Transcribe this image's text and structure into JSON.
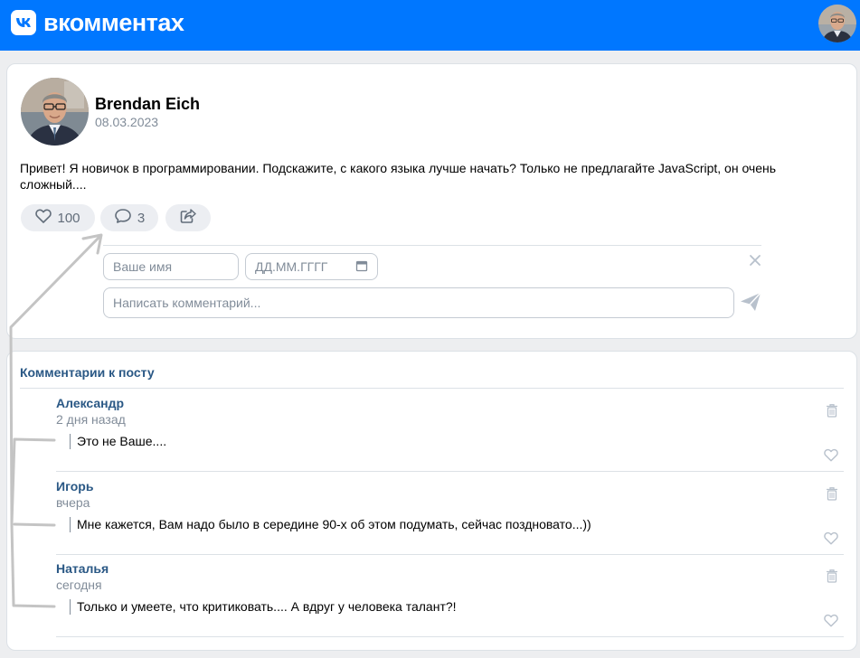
{
  "header": {
    "logo_text": "вкомментах"
  },
  "post": {
    "author_name": "Brendan Eich",
    "date": "08.03.2023",
    "text": "Привет! Я новичок в программировании. Подскажите, с какого языка лучше начать? Только не предлагайте JavaScript, он очень сложный....",
    "likes": "100",
    "comments_count": "3"
  },
  "form": {
    "name_placeholder": "Ваше имя",
    "date_placeholder": "ДД.ММ.ГГГГ",
    "comment_placeholder": "Написать комментарий..."
  },
  "comments_section": {
    "title": "Комментарии к посту",
    "items": [
      {
        "author": "Александр",
        "time": "2 дня назад",
        "text": "Это не Ваше...."
      },
      {
        "author": "Игорь",
        "time": "вчера",
        "text": "Мне кажется, Вам надо было в середине 90-х об этом подумать, сейчас поздновато...))"
      },
      {
        "author": "Наталья",
        "time": "сегодня",
        "text": "Только и умеете, что критиковать.... А вдруг у человека талант?!"
      }
    ]
  },
  "icons": [
    "vk-logo-icon",
    "user-avatar",
    "heart-icon",
    "comment-icon",
    "share-icon",
    "calendar-icon",
    "close-icon",
    "send-icon",
    "trash-icon"
  ],
  "colors": {
    "header_bg": "#0077ff",
    "link": "#2a5885",
    "muted": "#818c99",
    "pill_bg": "#eceef2",
    "page_bg": "#edeef0"
  }
}
